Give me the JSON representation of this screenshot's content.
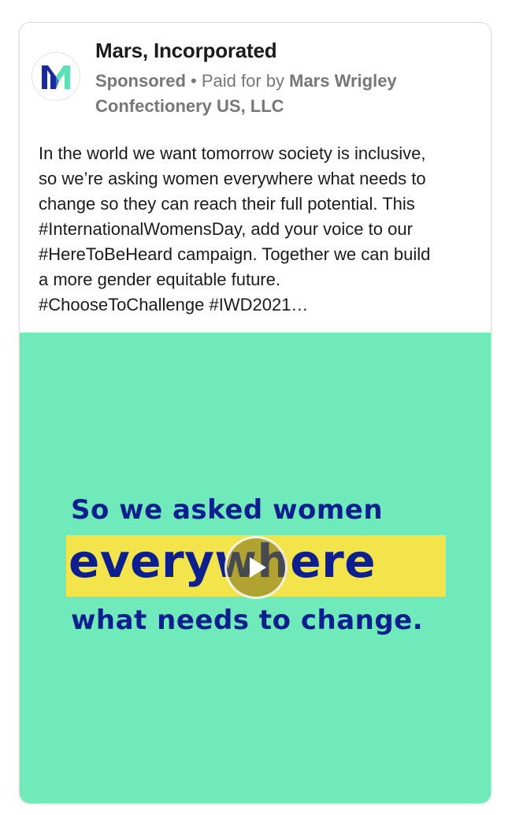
{
  "advertiser": {
    "name": "Mars, Incorporated",
    "sponsored_label": "Sponsored",
    "separator": " • ",
    "paid_for_prefix": "Paid for by ",
    "paid_for_entity": "Mars Wrigley Confectionery US, LLC",
    "logo_icon": "mars-m-logo-icon"
  },
  "post": {
    "text": "In the world we want tomorrow society is inclusive,\nso we’re asking women everywhere what needs to\nchange so they can reach their full potential. This\n#InternationalWomensDay, add your voice to our\n#HereToBeHeard campaign. Together we can build\na more gender equitable future.\n#ChooseToChallenge #IWD2021…"
  },
  "video": {
    "line1": "So we asked women",
    "line2": "everywhere",
    "line3": "what needs to change.",
    "play_icon": "play-icon"
  },
  "colors": {
    "media_background": "#70eabb",
    "highlight": "#f4e44b",
    "headline_text": "#0d1f8f",
    "logo_dark": "#1a2a9a",
    "logo_teal": "#5fe0b4"
  }
}
